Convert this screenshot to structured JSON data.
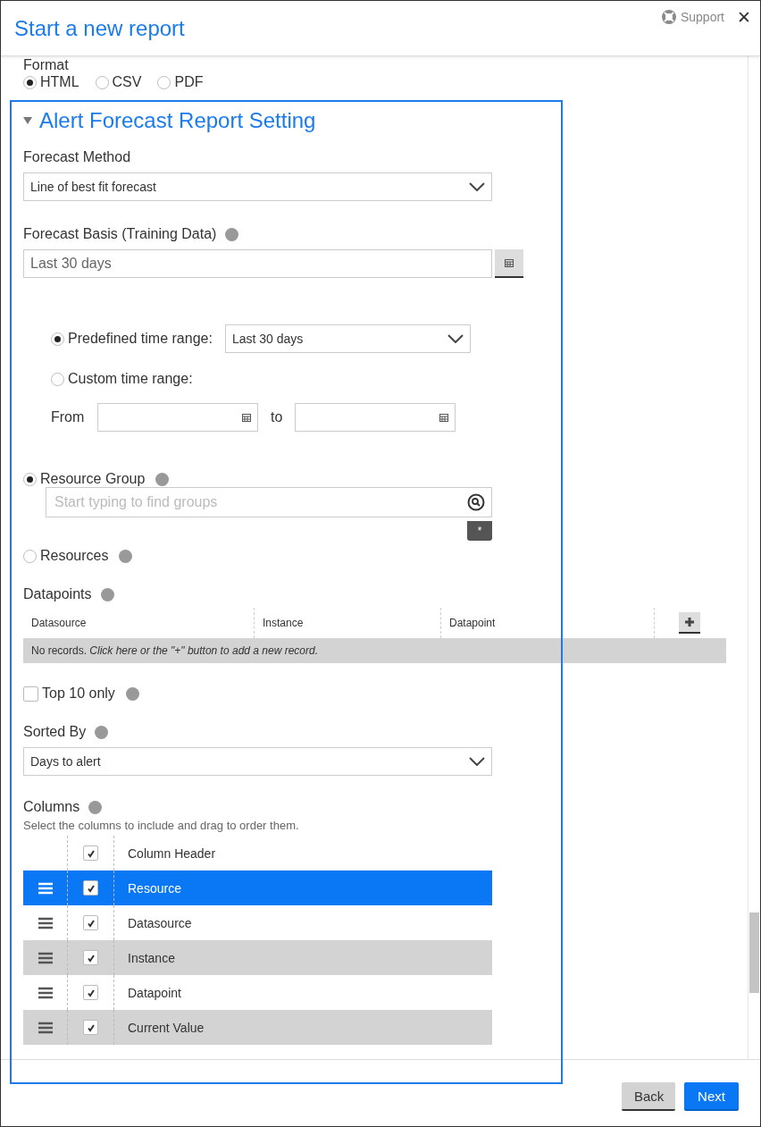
{
  "window": {
    "title": "Start a new report",
    "support": "Support",
    "close": "✕"
  },
  "format": {
    "label": "Format",
    "options": [
      {
        "label": "HTML",
        "selected": true
      },
      {
        "label": "CSV",
        "selected": false
      },
      {
        "label": "PDF",
        "selected": false
      }
    ]
  },
  "section": {
    "title": "Alert Forecast Report Setting",
    "expanded": true
  },
  "forecast_method": {
    "label": "Forecast Method",
    "value": "Line of best fit forecast"
  },
  "forecast_basis": {
    "label": "Forecast Basis (Training Data)",
    "value": "Last 30 days"
  },
  "time_range": {
    "options": [
      {
        "label": "Predefined time range:",
        "selected": true
      },
      {
        "label": "Custom time range:",
        "selected": false
      }
    ],
    "predefined_value": "Last 30 days",
    "from_label": "From",
    "to_label": "to"
  },
  "scope": {
    "options": [
      {
        "label": "Resource Group",
        "selected": true
      },
      {
        "label": "Resources",
        "selected": false
      }
    ],
    "placeholder": "Start typing to find groups",
    "tag": "*"
  },
  "datapoints": {
    "label": "Datapoints",
    "columns": [
      "Datasource",
      "Instance",
      "Datapoint"
    ],
    "empty_lead": "No records. *Click here or the \"+\" button to add a new record.*"
  },
  "top10": {
    "label": "Top 10 only",
    "checked": false
  },
  "sorted_by": {
    "label": "Sorted By",
    "value": "Days to alert"
  },
  "columns": {
    "label": "Columns",
    "hint": "Select the columns to include and drag to order them.",
    "header": {
      "label": "Column Header",
      "checked": true
    },
    "rows": [
      {
        "label": "Resource",
        "checked": true,
        "selected": true
      },
      {
        "label": "Datasource",
        "checked": true,
        "selected": false
      },
      {
        "label": "Instance",
        "checked": true,
        "selected": false
      },
      {
        "label": "Datapoint",
        "checked": true,
        "selected": false
      },
      {
        "label": "Current Value",
        "checked": true,
        "selected": false
      }
    ]
  },
  "buttons": {
    "back": "Back",
    "next": "Next"
  }
}
